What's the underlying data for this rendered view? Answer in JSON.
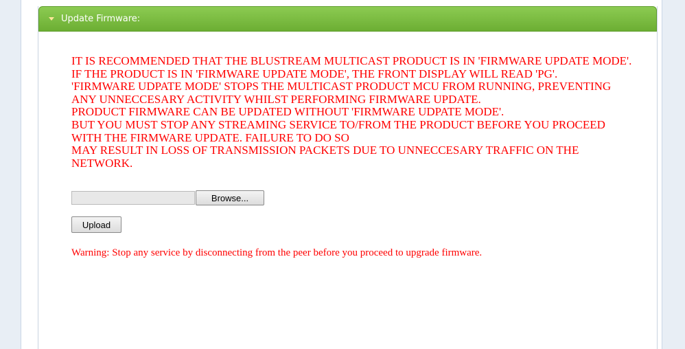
{
  "panel": {
    "title": "Update Firmware:"
  },
  "notice": {
    "lines": [
      "IT IS RECOMMENDED THAT THE BLUSTREAM MULTICAST PRODUCT IS IN 'FIRMWARE UPDATE MODE'.",
      "IF THE PRODUCT IS IN 'FIRMWARE UPDATE MODE', THE FRONT DISPLAY WILL READ 'PG'.",
      "'FIRMWARE UDPATE MODE' STOPS THE MULTICAST PRODUCT MCU FROM RUNNING, PREVENTING ANY UNNECCESARY ACTIVITY WHILST PERFORMING FIRMWARE UPDATE.",
      "PRODUCT FIRMWARE CAN BE UPDATED WITHOUT 'FIRMWARE UDPATE MODE'.",
      "BUT YOU MUST STOP ANY STREAMING SERVICE TO/FROM THE PRODUCT BEFORE YOU PROCEED WITH THE FIRMWARE UPDATE. FAILURE TO DO SO",
      "MAY RESULT IN LOSS OF TRANSMISSION PACKETS DUE TO UNNECCESARY TRAFFIC ON THE NETWORK."
    ]
  },
  "file_input": {
    "value": "",
    "browse_label": "Browse..."
  },
  "upload_label": "Upload",
  "warning": "Warning: Stop any service by disconnecting from the peer before you proceed to upgrade firmware.",
  "colors": {
    "header_green": "#7dbd44",
    "notice_red": "#ff0000"
  }
}
